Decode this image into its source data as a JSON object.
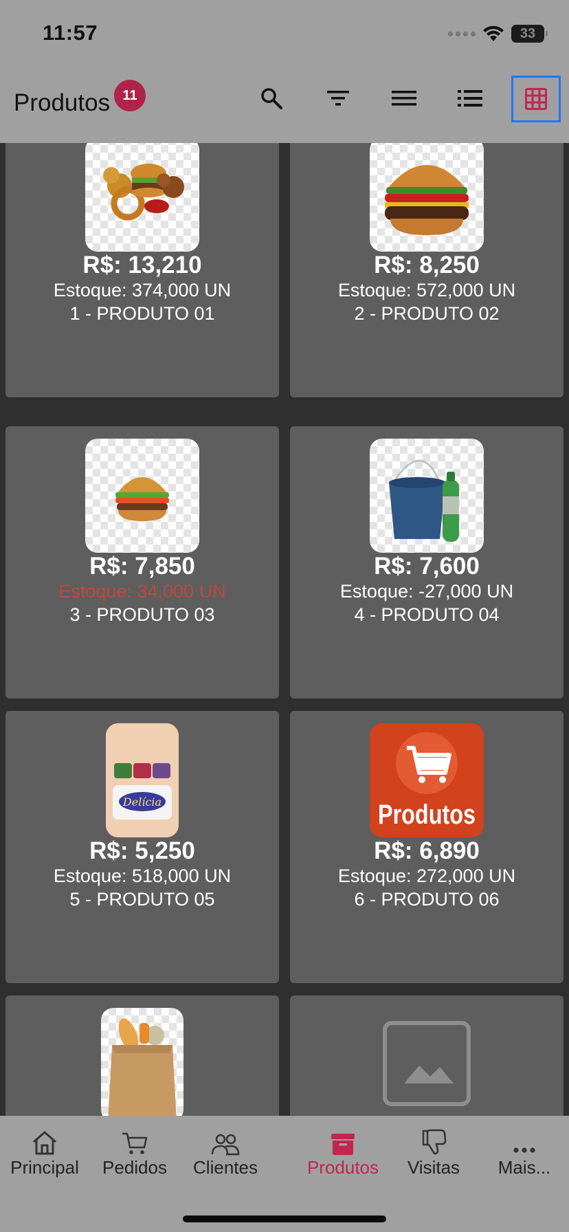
{
  "status_bar": {
    "time": "11:57",
    "battery": "33"
  },
  "app_bar": {
    "title": "Produtos",
    "badge_count": "11",
    "tools": [
      "search-icon",
      "filter-icon",
      "menu-icon",
      "list-icon",
      "grid-icon"
    ],
    "selected_tool": "grid-icon",
    "accent_color": "#c2254e",
    "selection_color": "#1e78ff"
  },
  "products": [
    {
      "price": "R$: 13,210",
      "stock": "Estoque: 374,000 UN",
      "name": "1 - PRODUTO 01",
      "image": "combo-icon"
    },
    {
      "price": "R$: 8,250",
      "stock": "Estoque: 572,000 UN",
      "name": "2 - PRODUTO 02",
      "image": "burger-icon"
    },
    {
      "price": "R$: 7,850",
      "stock": "Estoque: 34,000 UN",
      "name": "3 - PRODUTO 03",
      "image": "small-burger-icon",
      "stock_color": "#c0473f"
    },
    {
      "price": "R$: 7,600",
      "stock": "Estoque: -27,000 UN",
      "name": "4 - PRODUTO 04",
      "image": "bucket-icon"
    },
    {
      "price": "R$: 5,250",
      "stock": "Estoque: 518,000 UN",
      "name": "5 - PRODUTO 05",
      "image": "margarine-icon"
    },
    {
      "price": "R$: 6,890",
      "stock": "Estoque: 272,000 UN",
      "name": "6 - PRODUTO 06",
      "image": "cart-logo-icon"
    },
    {
      "image": "grocery-bag-icon"
    },
    {
      "image": "image-placeholder-icon"
    }
  ],
  "product_logo_text": "Produtos",
  "bottom_nav": [
    {
      "label": "Principal",
      "icon": "home-icon"
    },
    {
      "label": "Pedidos",
      "icon": "cart-icon"
    },
    {
      "label": "Clientes",
      "icon": "people-icon"
    },
    {
      "label": "Produtos",
      "icon": "box-icon",
      "active": true
    },
    {
      "label": "Visitas",
      "icon": "thumbs-down-icon"
    },
    {
      "label": "Mais...",
      "icon": "more-icon"
    }
  ]
}
